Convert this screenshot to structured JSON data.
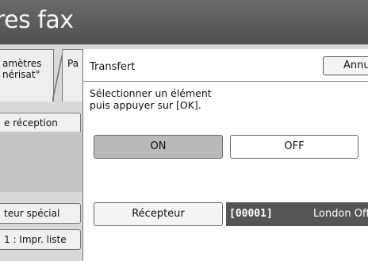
{
  "header": {
    "title": "res fax"
  },
  "tabs": [
    {
      "label_line1": "amètres",
      "label_line2": "nérisat°"
    },
    {
      "label": "Pa"
    }
  ],
  "left_buttons": {
    "reception_label": "e réception",
    "special_label": "teur spécial",
    "print_list_label": "1 : Impr. liste"
  },
  "dialog": {
    "title": "Transfert",
    "cancel_label": "Annuler",
    "instruction_line1": "Sélectionner un élément",
    "instruction_line2": "puis appuyer sur [OK].",
    "on_label": "ON",
    "off_label": "OFF",
    "on_selected": true,
    "receiver_button_label": "Récepteur",
    "receiver_code": "[00001]",
    "receiver_name": "London Office"
  }
}
